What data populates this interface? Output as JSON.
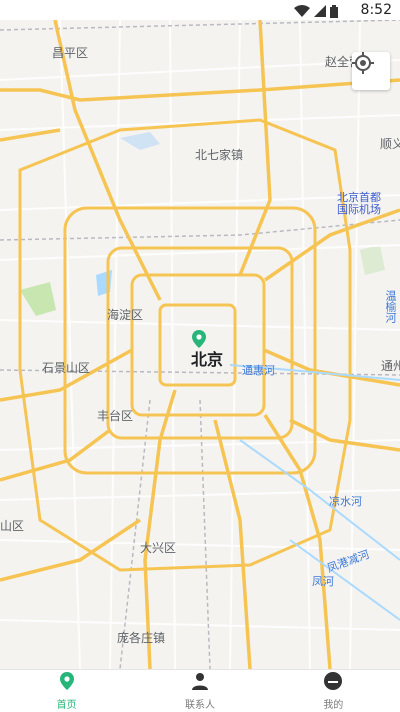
{
  "status_bar": {
    "time": "8:52"
  },
  "map": {
    "center_city": "北京",
    "labels": [
      {
        "text": "昌平区",
        "kind": "district"
      },
      {
        "text": "北七家镇",
        "kind": "district"
      },
      {
        "text": "赵全营",
        "kind": "district"
      },
      {
        "text": "顺义",
        "kind": "district"
      },
      {
        "text": "海淀区",
        "kind": "district"
      },
      {
        "text": "石景山区",
        "kind": "district"
      },
      {
        "text": "丰台区",
        "kind": "district"
      },
      {
        "text": "大兴区",
        "kind": "district"
      },
      {
        "text": "庞各庄镇",
        "kind": "district"
      },
      {
        "text": "通州",
        "kind": "district"
      },
      {
        "text": "山区",
        "kind": "district"
      },
      {
        "text": "通惠河",
        "kind": "water"
      },
      {
        "text": "凉水河",
        "kind": "water"
      },
      {
        "text": "凤港减河",
        "kind": "water"
      },
      {
        "text": "凤河",
        "kind": "water"
      },
      {
        "text": "温榆河",
        "kind": "water"
      },
      {
        "text": "北京首都国际机场",
        "kind": "airport"
      }
    ]
  },
  "nav": {
    "items": [
      {
        "label": "首页",
        "icon": "location-pin-icon",
        "active": true
      },
      {
        "label": "联系人",
        "icon": "person-icon",
        "active": false
      },
      {
        "label": "我的",
        "icon": "profile-icon",
        "active": false
      }
    ]
  },
  "colors": {
    "accent": "#27b57a",
    "road_major": "#f6c453",
    "road_minor": "#ffffff",
    "water": "#aadaff",
    "park": "#c7e6b0"
  }
}
